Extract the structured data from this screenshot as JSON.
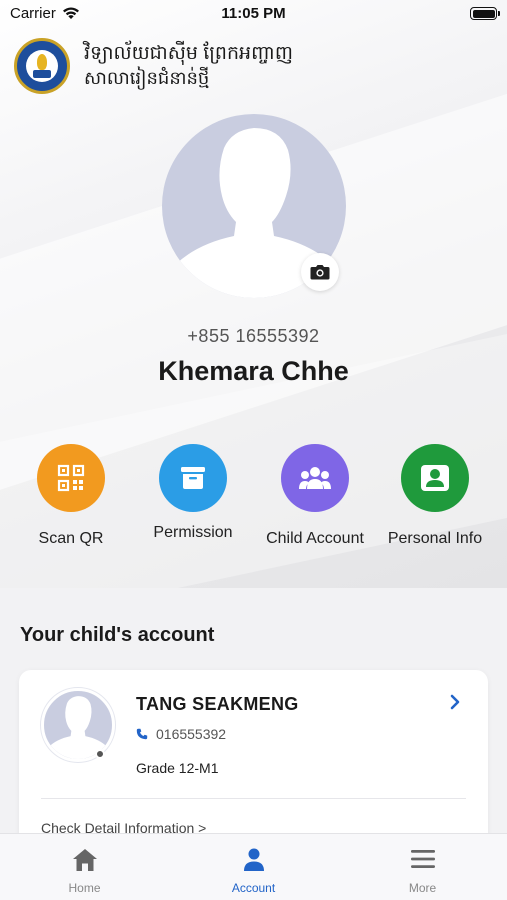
{
  "status_bar": {
    "carrier": "Carrier",
    "time": "11:05 PM"
  },
  "header": {
    "school_name": "វិទ្យាល័យជាស៊ីម ព្រែកអញ្ចាញ",
    "school_subtitle": "សាលារៀនជំនាន់ថ្មី"
  },
  "profile": {
    "phone": "+855 16555392",
    "name": "Khemara Chhe"
  },
  "actions": [
    {
      "label": "Scan QR",
      "icon": "qr-code-icon",
      "color": "#f29a1f"
    },
    {
      "label": "Permission",
      "icon": "permission-box-icon",
      "color": "#2b9de6"
    },
    {
      "label": "Child Account",
      "icon": "group-icon",
      "color": "#7f66e6"
    },
    {
      "label": "Personal Info",
      "icon": "person-badge-icon",
      "color": "#1f9a3c"
    }
  ],
  "child_section": {
    "title": "Your child's account",
    "child": {
      "name": "TANG SEAKMENG",
      "phone": "016555392",
      "grade": "Grade 12-M1",
      "detail_link": "Check Detail Information >"
    }
  },
  "tabbar": {
    "tabs": [
      {
        "label": "Home",
        "icon": "home-icon",
        "active": false
      },
      {
        "label": "Account",
        "icon": "account-icon",
        "active": true
      },
      {
        "label": "More",
        "icon": "menu-icon",
        "active": false
      }
    ]
  },
  "colors": {
    "accent": "#2264c8",
    "avatar_bg": "#c9cde0"
  }
}
